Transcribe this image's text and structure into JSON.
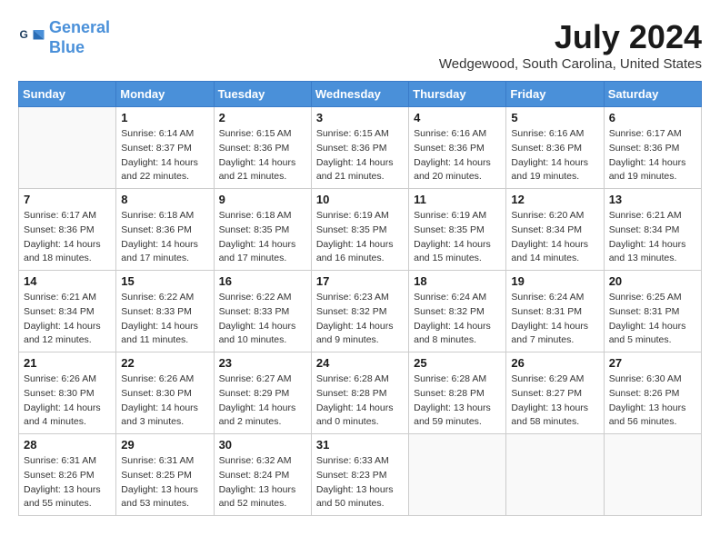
{
  "header": {
    "logo_line1": "General",
    "logo_line2": "Blue",
    "month_title": "July 2024",
    "location": "Wedgewood, South Carolina, United States"
  },
  "weekdays": [
    "Sunday",
    "Monday",
    "Tuesday",
    "Wednesday",
    "Thursday",
    "Friday",
    "Saturday"
  ],
  "weeks": [
    [
      {
        "day": "",
        "info": ""
      },
      {
        "day": "1",
        "info": "Sunrise: 6:14 AM\nSunset: 8:37 PM\nDaylight: 14 hours\nand 22 minutes."
      },
      {
        "day": "2",
        "info": "Sunrise: 6:15 AM\nSunset: 8:36 PM\nDaylight: 14 hours\nand 21 minutes."
      },
      {
        "day": "3",
        "info": "Sunrise: 6:15 AM\nSunset: 8:36 PM\nDaylight: 14 hours\nand 21 minutes."
      },
      {
        "day": "4",
        "info": "Sunrise: 6:16 AM\nSunset: 8:36 PM\nDaylight: 14 hours\nand 20 minutes."
      },
      {
        "day": "5",
        "info": "Sunrise: 6:16 AM\nSunset: 8:36 PM\nDaylight: 14 hours\nand 19 minutes."
      },
      {
        "day": "6",
        "info": "Sunrise: 6:17 AM\nSunset: 8:36 PM\nDaylight: 14 hours\nand 19 minutes."
      }
    ],
    [
      {
        "day": "7",
        "info": "Sunrise: 6:17 AM\nSunset: 8:36 PM\nDaylight: 14 hours\nand 18 minutes."
      },
      {
        "day": "8",
        "info": "Sunrise: 6:18 AM\nSunset: 8:36 PM\nDaylight: 14 hours\nand 17 minutes."
      },
      {
        "day": "9",
        "info": "Sunrise: 6:18 AM\nSunset: 8:35 PM\nDaylight: 14 hours\nand 17 minutes."
      },
      {
        "day": "10",
        "info": "Sunrise: 6:19 AM\nSunset: 8:35 PM\nDaylight: 14 hours\nand 16 minutes."
      },
      {
        "day": "11",
        "info": "Sunrise: 6:19 AM\nSunset: 8:35 PM\nDaylight: 14 hours\nand 15 minutes."
      },
      {
        "day": "12",
        "info": "Sunrise: 6:20 AM\nSunset: 8:34 PM\nDaylight: 14 hours\nand 14 minutes."
      },
      {
        "day": "13",
        "info": "Sunrise: 6:21 AM\nSunset: 8:34 PM\nDaylight: 14 hours\nand 13 minutes."
      }
    ],
    [
      {
        "day": "14",
        "info": "Sunrise: 6:21 AM\nSunset: 8:34 PM\nDaylight: 14 hours\nand 12 minutes."
      },
      {
        "day": "15",
        "info": "Sunrise: 6:22 AM\nSunset: 8:33 PM\nDaylight: 14 hours\nand 11 minutes."
      },
      {
        "day": "16",
        "info": "Sunrise: 6:22 AM\nSunset: 8:33 PM\nDaylight: 14 hours\nand 10 minutes."
      },
      {
        "day": "17",
        "info": "Sunrise: 6:23 AM\nSunset: 8:32 PM\nDaylight: 14 hours\nand 9 minutes."
      },
      {
        "day": "18",
        "info": "Sunrise: 6:24 AM\nSunset: 8:32 PM\nDaylight: 14 hours\nand 8 minutes."
      },
      {
        "day": "19",
        "info": "Sunrise: 6:24 AM\nSunset: 8:31 PM\nDaylight: 14 hours\nand 7 minutes."
      },
      {
        "day": "20",
        "info": "Sunrise: 6:25 AM\nSunset: 8:31 PM\nDaylight: 14 hours\nand 5 minutes."
      }
    ],
    [
      {
        "day": "21",
        "info": "Sunrise: 6:26 AM\nSunset: 8:30 PM\nDaylight: 14 hours\nand 4 minutes."
      },
      {
        "day": "22",
        "info": "Sunrise: 6:26 AM\nSunset: 8:30 PM\nDaylight: 14 hours\nand 3 minutes."
      },
      {
        "day": "23",
        "info": "Sunrise: 6:27 AM\nSunset: 8:29 PM\nDaylight: 14 hours\nand 2 minutes."
      },
      {
        "day": "24",
        "info": "Sunrise: 6:28 AM\nSunset: 8:28 PM\nDaylight: 14 hours\nand 0 minutes."
      },
      {
        "day": "25",
        "info": "Sunrise: 6:28 AM\nSunset: 8:28 PM\nDaylight: 13 hours\nand 59 minutes."
      },
      {
        "day": "26",
        "info": "Sunrise: 6:29 AM\nSunset: 8:27 PM\nDaylight: 13 hours\nand 58 minutes."
      },
      {
        "day": "27",
        "info": "Sunrise: 6:30 AM\nSunset: 8:26 PM\nDaylight: 13 hours\nand 56 minutes."
      }
    ],
    [
      {
        "day": "28",
        "info": "Sunrise: 6:31 AM\nSunset: 8:26 PM\nDaylight: 13 hours\nand 55 minutes."
      },
      {
        "day": "29",
        "info": "Sunrise: 6:31 AM\nSunset: 8:25 PM\nDaylight: 13 hours\nand 53 minutes."
      },
      {
        "day": "30",
        "info": "Sunrise: 6:32 AM\nSunset: 8:24 PM\nDaylight: 13 hours\nand 52 minutes."
      },
      {
        "day": "31",
        "info": "Sunrise: 6:33 AM\nSunset: 8:23 PM\nDaylight: 13 hours\nand 50 minutes."
      },
      {
        "day": "",
        "info": ""
      },
      {
        "day": "",
        "info": ""
      },
      {
        "day": "",
        "info": ""
      }
    ]
  ]
}
